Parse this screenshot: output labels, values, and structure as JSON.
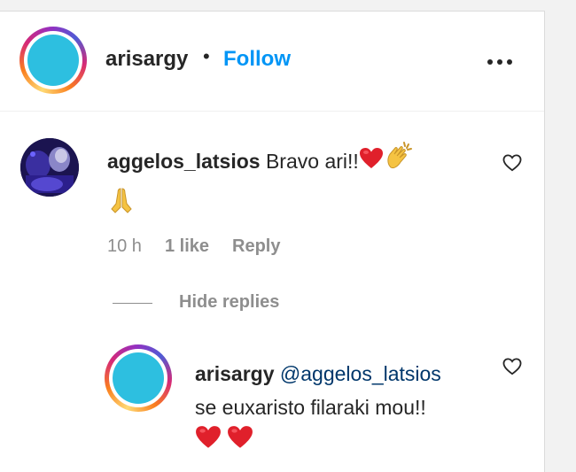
{
  "post_header": {
    "username": "arisargy",
    "separator": "•",
    "follow_label": "Follow",
    "more_icon": "more-horizontal-icon"
  },
  "comment": {
    "username": "aggelos_latsios",
    "text": "Bravo ari!!",
    "emojis": [
      "red-heart",
      "clapping-hands",
      "folded-hands"
    ],
    "time": "10 h",
    "likes": "1 like",
    "reply_label": "Reply",
    "hide_replies_label": "Hide replies"
  },
  "reply": {
    "username": "arisargy",
    "mention": "@aggelos_latsios",
    "text": "se euxaristo filaraki mou!!",
    "emojis": [
      "red-heart",
      "red-heart"
    ]
  },
  "colors": {
    "link_blue": "#0095f6",
    "avatar_fill": "#2dbfe0",
    "muted_text": "#8e8e8e",
    "heart_red": "#e0202b"
  }
}
